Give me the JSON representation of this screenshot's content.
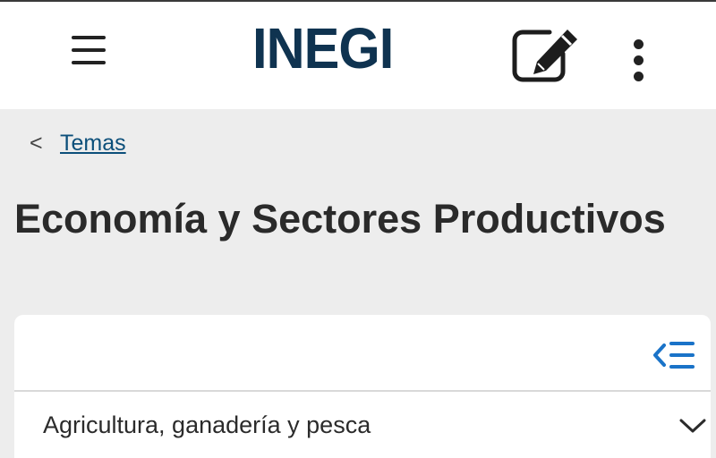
{
  "header": {
    "logo_text": "INEGI",
    "menu_icon": "hamburger-menu-icon",
    "edit_icon": "edit-note-icon",
    "more_icon": "more-vertical-icon"
  },
  "breadcrumb": {
    "back_symbol": "<",
    "link_label": "Temas"
  },
  "page": {
    "title": "Economía y Sectores Productivos"
  },
  "sections": {
    "toc_icon": "collapse-list-icon",
    "items": [
      {
        "label": "Agricultura, ganadería y pesca",
        "expanded": false
      }
    ]
  },
  "colors": {
    "brand": "#0f3350",
    "link": "#0c4f7a",
    "accent": "#1a73c8",
    "background": "#ededed"
  }
}
